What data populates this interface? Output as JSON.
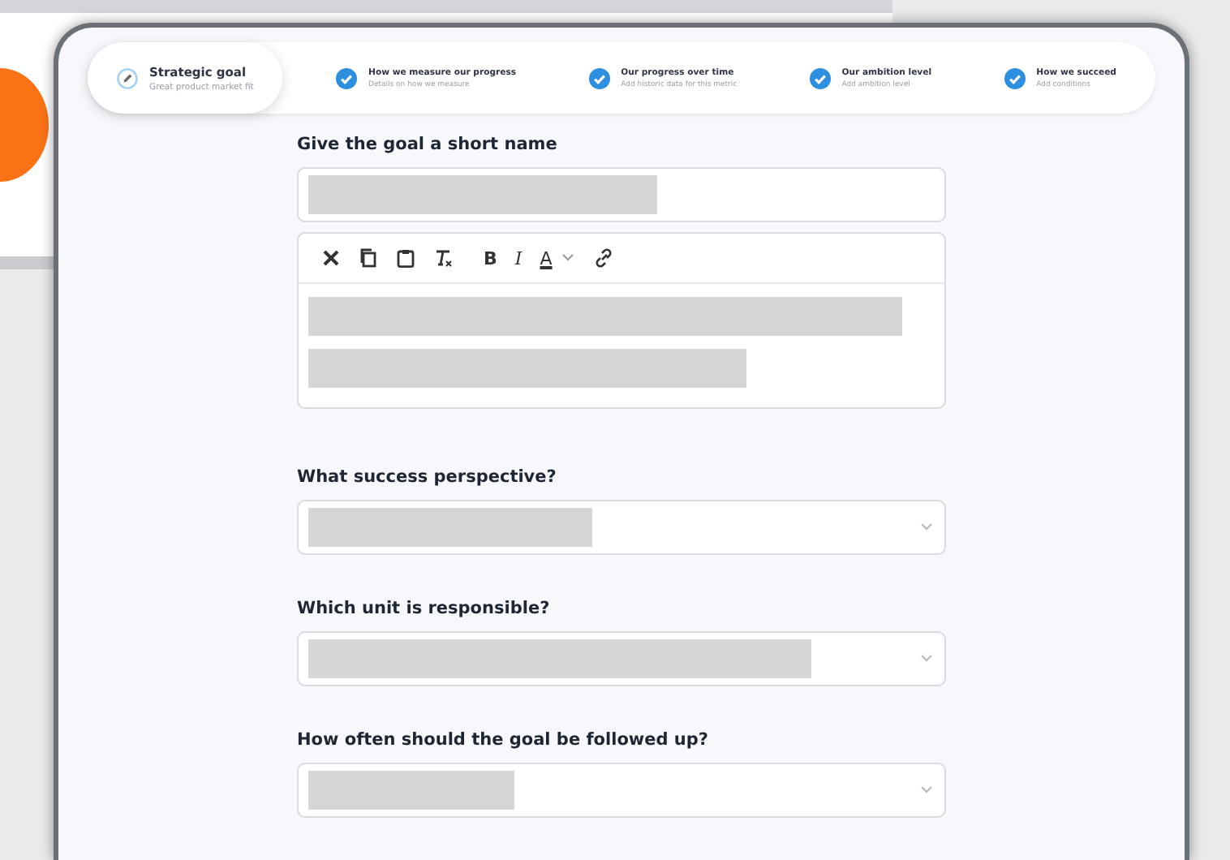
{
  "steps": [
    {
      "title": "Strategic goal",
      "subtitle": "Great product market fit",
      "selected": true,
      "completed": false
    },
    {
      "title": "How we measure our progress",
      "subtitle": "Details on how we measure",
      "selected": false,
      "completed": true
    },
    {
      "title": "Our progress over time",
      "subtitle": "Add historic data for this metric",
      "selected": false,
      "completed": true
    },
    {
      "title": "Our ambition level",
      "subtitle": "Add ambition level",
      "selected": false,
      "completed": true
    },
    {
      "title": "How we succeed",
      "subtitle": "Add conditions",
      "selected": false,
      "completed": true
    }
  ],
  "form": [
    {
      "kind": "text",
      "label": "Give the goal a short name"
    },
    {
      "kind": "editor",
      "toolbar": [
        {
          "kind": "cut"
        },
        {
          "kind": "copy"
        },
        {
          "kind": "paste"
        },
        {
          "kind": "clear-format"
        },
        {
          "kind": "bold",
          "glyph": "B"
        },
        {
          "kind": "italic",
          "glyph": "I"
        },
        {
          "kind": "text-color",
          "glyph": "A"
        },
        {
          "kind": "link"
        }
      ]
    },
    {
      "kind": "select",
      "label": "What success perspective?"
    },
    {
      "kind": "select",
      "label": "Which unit is responsible?"
    },
    {
      "kind": "select",
      "label": "How often should the goal be followed up?"
    }
  ]
}
